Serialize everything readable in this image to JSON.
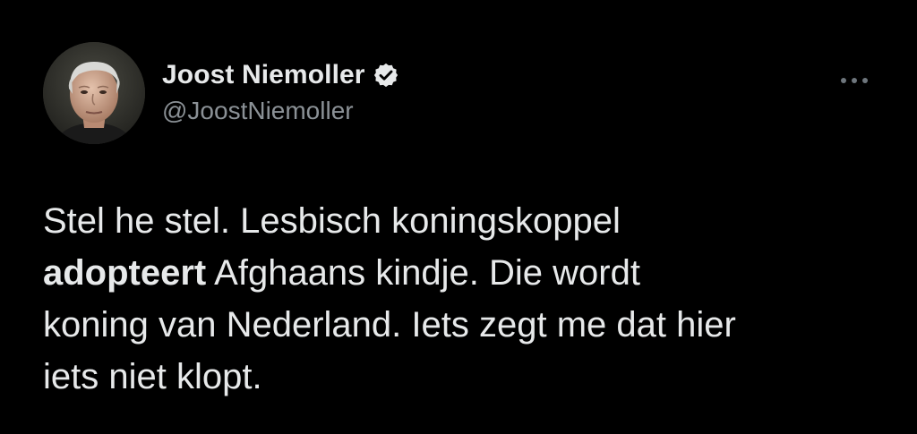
{
  "author": {
    "display_name": "Joost Niemoller",
    "handle": "@JoostNiemoller",
    "verified": true,
    "avatar_icon": "profile-photo"
  },
  "menu": {
    "icon": "more-dots-icon"
  },
  "tweet": {
    "line1": "Stel he stel. Lesbisch koningskoppel",
    "bold_word": "adopteert",
    "line2_rest": " Afghaans kindje. Die wordt",
    "line3": "koning van Nederland. Iets zegt me dat hier",
    "line4": "iets niet klopt."
  },
  "colors": {
    "background": "#000000",
    "text": "#e7e9ea",
    "secondary_text": "#8b9196",
    "verified_badge": "#e7e9ea"
  }
}
